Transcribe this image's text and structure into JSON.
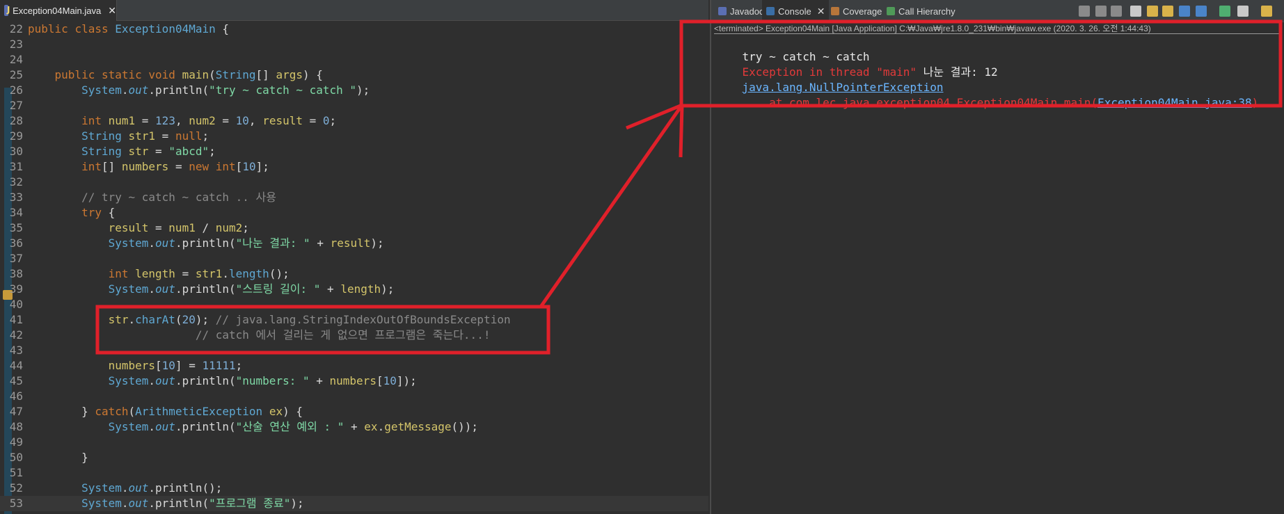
{
  "editor": {
    "tab_label": "Exception04Main.java",
    "lines": [
      {
        "num": "22",
        "html": "<span class='kw'>public</span> <span class='kw'>class</span> <span class='ty'>Exception04Main</span> {"
      },
      {
        "num": "23",
        "html": ""
      },
      {
        "num": "24",
        "html": ""
      },
      {
        "num": "25",
        "html": "    <span class='kw'>public</span> <span class='kw'>static</span> <span class='kw'>void</span> <span class='var'>main</span>(<span class='ty'>String</span>[] <span class='var'>args</span>) {"
      },
      {
        "num": "26",
        "html": "        <span class='ty'>System</span>.<span class='fld'>out</span>.println(<span class='str'>\"try ~ catch ~ catch \"</span>);"
      },
      {
        "num": "27",
        "html": ""
      },
      {
        "num": "28",
        "html": "        <span class='kw'>int</span> <span class='var'>num1</span> = <span class='num'>123</span>, <span class='var'>num2</span> = <span class='num'>10</span>, <span class='var'>result</span> = <span class='num'>0</span>;"
      },
      {
        "num": "29",
        "html": "        <span class='ty'>String</span> <span class='var'>str1</span> = <span class='kw'>null</span>;"
      },
      {
        "num": "30",
        "html": "        <span class='ty'>String</span> <span class='var'>str</span> = <span class='str'>\"abcd\"</span>;"
      },
      {
        "num": "31",
        "html": "        <span class='kw'>int</span>[] <span class='var'>numbers</span> = <span class='kw'>new</span> <span class='kw'>int</span>[<span class='num'>10</span>];"
      },
      {
        "num": "32",
        "html": ""
      },
      {
        "num": "33",
        "html": "        <span class='cmt'>// try ~ catch ~ catch .. 사용</span>"
      },
      {
        "num": "34",
        "html": "        <span class='kw'>try</span> {"
      },
      {
        "num": "35",
        "html": "            <span class='var'>result</span> = <span class='var'>num1</span> / <span class='var'>num2</span>;"
      },
      {
        "num": "36",
        "html": "            <span class='ty'>System</span>.<span class='fld'>out</span>.println(<span class='str'>\"나눈 결과: \"</span> + <span class='var'>result</span>);"
      },
      {
        "num": "37",
        "html": ""
      },
      {
        "num": "38",
        "html": "            <span class='kw'>int</span> <span class='var'>length</span> = <span class='var'>str1</span>.<span class='ty'>length</span>();"
      },
      {
        "num": "39",
        "html": "            <span class='ty'>System</span>.<span class='fld'>out</span>.println(<span class='str'>\"스트링 길이: \"</span> + <span class='var'>length</span>);"
      },
      {
        "num": "40",
        "html": ""
      },
      {
        "num": "41",
        "html": "            <span class='var'>str</span>.<span class='ty'>charAt</span>(<span class='num'>20</span>); <span class='cmt'>// java.lang.StringIndexOutOfBoundsException</span>"
      },
      {
        "num": "42",
        "html": "                         <span class='cmt'>// catch 에서 걸리는 게 없으면 프로그램은 죽는다...!</span>"
      },
      {
        "num": "43",
        "html": ""
      },
      {
        "num": "44",
        "html": "            <span class='var'>numbers</span>[<span class='num'>10</span>] = <span class='num'>11111</span>;"
      },
      {
        "num": "45",
        "html": "            <span class='ty'>System</span>.<span class='fld'>out</span>.println(<span class='str'>\"numbers: \"</span> + <span class='var'>numbers</span>[<span class='num'>10</span>]);"
      },
      {
        "num": "46",
        "html": ""
      },
      {
        "num": "47",
        "html": "        } <span class='kw'>catch</span>(<span class='ty'>ArithmeticException</span> <span class='var'>ex</span>) {"
      },
      {
        "num": "48",
        "html": "            <span class='ty'>System</span>.<span class='fld'>out</span>.println(<span class='str'>\"산술 연산 예외 : \"</span> + <span class='var'>ex</span>.<span class='var'>getMessage</span>());"
      },
      {
        "num": "49",
        "html": ""
      },
      {
        "num": "50",
        "html": "        }"
      },
      {
        "num": "51",
        "html": ""
      },
      {
        "num": "52",
        "html": "        <span class='ty'>System</span>.<span class='fld'>out</span>.println();"
      },
      {
        "num": "53",
        "html": "        <span class='ty'>System</span>.<span class='fld'>out</span>.println(<span class='str'>\"프로그램 종료\"</span>);"
      }
    ]
  },
  "console": {
    "tabs": [
      {
        "label": "Javadoc",
        "icon": "javadoc-icon"
      },
      {
        "label": "Console",
        "icon": "console-icon",
        "active": true
      },
      {
        "label": "Coverage",
        "icon": "coverage-icon"
      },
      {
        "label": "Call Hierarchy",
        "icon": "call-hierarchy-icon"
      }
    ],
    "header": "<terminated> Exception04Main [Java Application] C:₩Java₩jre1.8.0_231₩bin₩javaw.exe (2020. 3. 26. 오전 1:44:43)",
    "output": [
      {
        "type": "out",
        "text": "try ~ catch ~ catch"
      },
      {
        "type": "mixed",
        "err": "Exception in thread \"main\" ",
        "out": "나눈 결과: 12"
      },
      {
        "type": "link",
        "text": "java.lang.NullPointerException"
      },
      {
        "type": "trace",
        "prefix": "\tat com.lec.java.exception04.Exception04Main.main(",
        "link": "Exception04Main.java:38",
        "suffix": ")"
      }
    ]
  },
  "colors": {
    "annotation_red": "#e0202a",
    "editor_bg": "#2f2f2f",
    "string_green": "#7fd9a6",
    "keyword_orange": "#cc7832",
    "type_blue": "#5fa8d3",
    "error_red": "#e23a3a",
    "link_blue": "#6bb6ff"
  }
}
